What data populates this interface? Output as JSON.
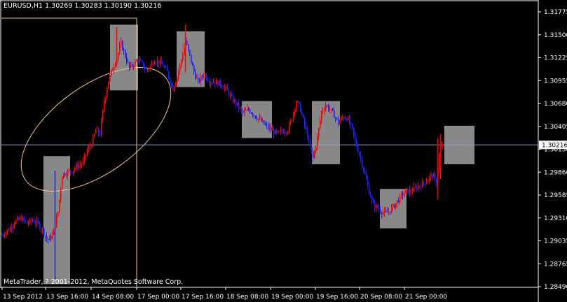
{
  "header": {
    "symbol": "EURUSD,H1",
    "open": "1.30269",
    "high": "1.30283",
    "low": "1.30190",
    "close": "1.30216"
  },
  "copyright": "MetaTrader, ? 2001-2012, MetaQuotes Software Corp.",
  "colors": {
    "background": "#000000",
    "bull": "#ff0000",
    "bear": "#1e1eff",
    "axis": "#ffffff",
    "bid_line": "#8fa3c8",
    "highlight_box": "#a0a0a0",
    "ellipse": "#f4c48c",
    "crosshair": "#f4c48c"
  },
  "chart_data": {
    "type": "candlestick",
    "ylim": [
      1.2849,
      1.3187
    ],
    "price_ticks": [
      "1.31775",
      "1.31500",
      "1.31225",
      "1.30955",
      "1.30680",
      "1.30405",
      "1.30130",
      "1.29860",
      "1.29585",
      "1.29310",
      "1.29035",
      "1.28765",
      "1.28490"
    ],
    "current_price": "1.30216",
    "time_ticks": [
      "13 Sep 2012",
      "13 Sep 16:00",
      "14 Sep 08:00",
      "17 Sep 00:00",
      "17 Sep 16:00",
      "18 Sep 08:00",
      "19 Sep 00:00",
      "19 Sep 16:00",
      "20 Sep 08:00",
      "21 Sep 00:00"
    ],
    "path": [
      [
        0,
        1.2912
      ],
      [
        10,
        1.2918
      ],
      [
        18,
        1.2928
      ],
      [
        28,
        1.2932
      ],
      [
        36,
        1.2926
      ],
      [
        44,
        1.293
      ],
      [
        52,
        1.2925
      ],
      [
        58,
        1.2918
      ],
      [
        65,
        1.2905
      ],
      [
        73,
        1.2912
      ],
      [
        80,
        1.294
      ],
      [
        86,
        1.2985
      ],
      [
        92,
        1.2988
      ],
      [
        100,
        1.299
      ],
      [
        108,
        1.2996
      ],
      [
        116,
        1.3
      ],
      [
        122,
        1.3015
      ],
      [
        128,
        1.3022
      ],
      [
        134,
        1.304
      ],
      [
        140,
        1.3035
      ],
      [
        146,
        1.3075
      ],
      [
        152,
        1.31
      ],
      [
        158,
        1.3115
      ],
      [
        164,
        1.3128
      ],
      [
        170,
        1.3145
      ],
      [
        176,
        1.313
      ],
      [
        182,
        1.3115
      ],
      [
        188,
        1.312
      ],
      [
        194,
        1.3125
      ],
      [
        200,
        1.312
      ],
      [
        206,
        1.3112
      ],
      [
        212,
        1.3118
      ],
      [
        218,
        1.3125
      ],
      [
        224,
        1.3122
      ],
      [
        230,
        1.3118
      ],
      [
        236,
        1.311
      ],
      [
        244,
        1.309
      ],
      [
        250,
        1.3105
      ],
      [
        256,
        1.3125
      ],
      [
        262,
        1.3148
      ],
      [
        268,
        1.313
      ],
      [
        274,
        1.311
      ],
      [
        280,
        1.3098
      ],
      [
        288,
        1.3108
      ],
      [
        296,
        1.31
      ],
      [
        304,
        1.3098
      ],
      [
        312,
        1.3096
      ],
      [
        320,
        1.309
      ],
      [
        328,
        1.3078
      ],
      [
        336,
        1.307
      ],
      [
        344,
        1.306
      ],
      [
        352,
        1.3065
      ],
      [
        360,
        1.3058
      ],
      [
        368,
        1.3052
      ],
      [
        376,
        1.3045
      ],
      [
        384,
        1.304
      ],
      [
        392,
        1.3035
      ],
      [
        400,
        1.3038
      ],
      [
        408,
        1.304
      ],
      [
        414,
        1.3055
      ],
      [
        420,
        1.3075
      ],
      [
        426,
        1.3065
      ],
      [
        432,
        1.3045
      ],
      [
        438,
        1.3025
      ],
      [
        444,
        1.3005
      ],
      [
        450,
        1.303
      ],
      [
        456,
        1.3062
      ],
      [
        462,
        1.307
      ],
      [
        468,
        1.3065
      ],
      [
        474,
        1.3058
      ],
      [
        480,
        1.3048
      ],
      [
        486,
        1.3055
      ],
      [
        492,
        1.3055
      ],
      [
        500,
        1.304
      ],
      [
        506,
        1.302
      ],
      [
        512,
        1.3005
      ],
      [
        518,
        1.2985
      ],
      [
        524,
        1.2965
      ],
      [
        530,
        1.2948
      ],
      [
        536,
        1.2945
      ],
      [
        542,
        1.294
      ],
      [
        548,
        1.2938
      ],
      [
        554,
        1.2942
      ],
      [
        560,
        1.2948
      ],
      [
        566,
        1.2955
      ],
      [
        572,
        1.2962
      ],
      [
        578,
        1.2965
      ],
      [
        584,
        1.2966
      ],
      [
        590,
        1.2968
      ],
      [
        596,
        1.2972
      ],
      [
        602,
        1.2975
      ],
      [
        608,
        1.298
      ],
      [
        614,
        1.2985
      ],
      [
        620,
        1.2975
      ],
      [
        624,
        1.301
      ],
      [
        628,
        1.302
      ]
    ],
    "highlight_boxes": [
      {
        "t0": 60,
        "t1": 98,
        "p_high": 1.3008,
        "p_low": 1.2852
      },
      {
        "t0": 155,
        "t1": 195,
        "p_high": 1.3168,
        "p_low": 1.3088
      },
      {
        "t0": 250,
        "t1": 290,
        "p_high": 1.316,
        "p_low": 1.3092
      },
      {
        "t0": 343,
        "t1": 386,
        "p_high": 1.3075,
        "p_low": 1.303
      },
      {
        "t0": 443,
        "t1": 483,
        "p_high": 1.3075,
        "p_low": 1.2998
      },
      {
        "t0": 540,
        "t1": 578,
        "p_high": 1.2968,
        "p_low": 1.292
      },
      {
        "t0": 632,
        "t1": 675,
        "p_high": 1.3045,
        "p_low": 1.2998
      }
    ]
  }
}
